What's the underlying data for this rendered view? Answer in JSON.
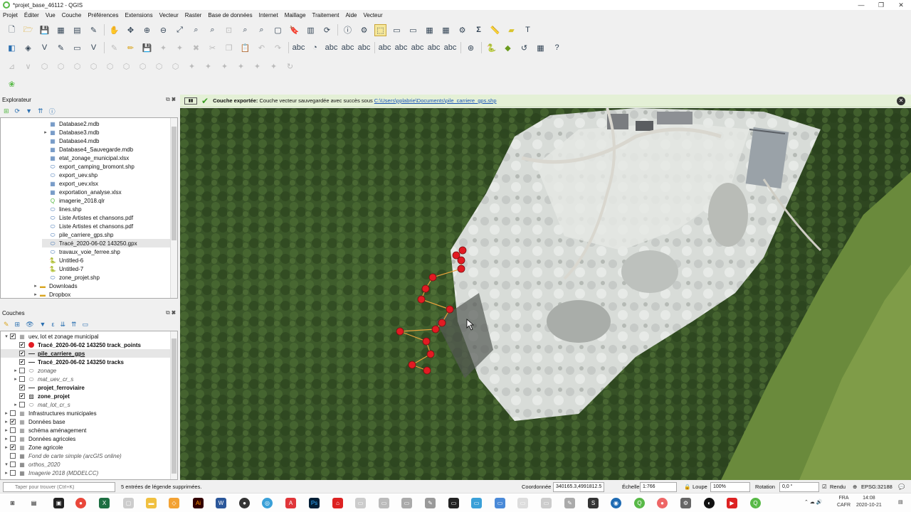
{
  "window": {
    "title": "*projet_base_46112 - QGIS",
    "controls": [
      "—",
      "❐",
      "✕"
    ]
  },
  "menu": [
    "Projet",
    "Éditer",
    "Vue",
    "Couche",
    "Préférences",
    "Extensions",
    "Vecteur",
    "Raster",
    "Base de données",
    "Internet",
    "Maillage",
    "Traitement",
    "Aide",
    "Vecteur"
  ],
  "explorer": {
    "title": "Explorateur",
    "items": [
      {
        "label": "Database2.mdb",
        "icon": "table-icon",
        "arrow": ""
      },
      {
        "label": "Database3.mdb",
        "icon": "table-icon",
        "arrow": "▸"
      },
      {
        "label": "Database4.mdb",
        "icon": "table-icon",
        "arrow": ""
      },
      {
        "label": "Database4_Sauvegarde.mdb",
        "icon": "table-icon",
        "arrow": ""
      },
      {
        "label": "etat_zonage_municipal.xlsx",
        "icon": "table-icon",
        "arrow": ""
      },
      {
        "label": "export_camping_bromont.shp",
        "icon": "vector-icon",
        "arrow": ""
      },
      {
        "label": "export_uev.shp",
        "icon": "vector-icon",
        "arrow": ""
      },
      {
        "label": "export_uev.xlsx",
        "icon": "table-icon",
        "arrow": ""
      },
      {
        "label": "exportation_analyse.xlsx",
        "icon": "table-icon",
        "arrow": ""
      },
      {
        "label": "imagerie_2018.qlr",
        "icon": "qgis-icon",
        "arrow": ""
      },
      {
        "label": "lines.shp",
        "icon": "vector-icon",
        "arrow": ""
      },
      {
        "label": "Liste Artistes et chansons.pdf",
        "icon": "vector-icon",
        "arrow": ""
      },
      {
        "label": "Liste Artistes et chansons.pdf",
        "icon": "vector-icon",
        "arrow": ""
      },
      {
        "label": "pile_carriere_gps.shp",
        "icon": "vector-icon",
        "arrow": ""
      },
      {
        "label": "Tracé_2020-06-02 143250.gpx",
        "icon": "vector-icon",
        "arrow": "",
        "selected": true
      },
      {
        "label": "travaux_voie_ferree.shp",
        "icon": "vector-icon",
        "arrow": ""
      },
      {
        "label": "Untitled-6",
        "icon": "python-icon",
        "arrow": ""
      },
      {
        "label": "Untitled-7",
        "icon": "python-icon",
        "arrow": ""
      },
      {
        "label": "zone_projet.shp",
        "icon": "vector-icon",
        "arrow": ""
      },
      {
        "label": "Downloads",
        "icon": "folder-icon",
        "arrow": "▸",
        "level": 1
      },
      {
        "label": "Dropbox",
        "icon": "folder-icon",
        "arrow": "▸",
        "level": 1
      }
    ]
  },
  "layers": {
    "title": "Couches",
    "items": [
      {
        "label": "uev, lot et zonage municipal",
        "style": "",
        "checked": true,
        "arrow": "▾",
        "icon": "group-icon",
        "level": 0
      },
      {
        "label": "Tracé_2020-06-02 143250 track_points",
        "style": "bold",
        "checked": true,
        "arrow": "",
        "icon": "red-dot-icon",
        "level": 1
      },
      {
        "label": "pile_carriere_gps",
        "style": "underline",
        "checked": true,
        "arrow": "",
        "icon": "line-icon",
        "level": 1
      },
      {
        "label": "Tracé_2020-06-02 143250 tracks",
        "style": "bold",
        "checked": true,
        "arrow": "",
        "icon": "line-icon",
        "level": 1
      },
      {
        "label": "zonage",
        "style": "ital",
        "checked": false,
        "arrow": "▸",
        "icon": "",
        "level": 1
      },
      {
        "label": "mat_uev_cr_s",
        "style": "ital",
        "checked": false,
        "arrow": "▸",
        "icon": "",
        "level": 1
      },
      {
        "label": "projet_ferroviaire",
        "style": "bold",
        "checked": true,
        "arrow": "",
        "icon": "line-icon",
        "level": 1
      },
      {
        "label": "zone_projet",
        "style": "bold",
        "checked": true,
        "arrow": "",
        "icon": "hatch-icon",
        "level": 1
      },
      {
        "label": "mat_lot_cr_s",
        "style": "ital",
        "checked": false,
        "arrow": "▸",
        "icon": "",
        "level": 1
      },
      {
        "label": "Infrastructures municipales",
        "style": "",
        "checked": false,
        "arrow": "▸",
        "icon": "group-icon",
        "level": 0
      },
      {
        "label": "Données base",
        "style": "",
        "checked": true,
        "arrow": "▸",
        "icon": "group-icon",
        "level": 0
      },
      {
        "label": "schéma aménagement",
        "style": "",
        "checked": false,
        "arrow": "▸",
        "icon": "group-icon",
        "level": 0
      },
      {
        "label": "Données agricoles",
        "style": "",
        "checked": false,
        "arrow": "▸",
        "icon": "group-icon",
        "level": 0
      },
      {
        "label": "Zone agricole",
        "style": "",
        "checked": true,
        "arrow": "▸",
        "icon": "group-icon",
        "level": 0
      },
      {
        "label": "Fond de carte simple (arcGIS online)",
        "style": "ital",
        "checked": false,
        "arrow": "",
        "icon": "raster-icon",
        "level": 0
      },
      {
        "label": "orthos_2020",
        "style": "ital",
        "checked": false,
        "arrow": "▾",
        "icon": "raster-icon",
        "level": 0
      },
      {
        "label": "Imagerie 2018 (MDDELCC)",
        "style": "ital",
        "checked": false,
        "arrow": "▸",
        "icon": "raster-icon",
        "level": 0
      }
    ]
  },
  "message": {
    "title": "Couche exportée:",
    "text": "Couche vecteur sauvegardée avec succès sous",
    "link": "C:\\Users\\pplabrie\\Documents\\pile_carriere_gps.shp"
  },
  "status": {
    "search_placeholder": "Taper pour trouver (Ctrl+K)",
    "message": "5 entrées de légende supprimées.",
    "coord_label": "Coordonnée",
    "coord_value": "340165.3,4991812.5",
    "scale_label": "Échelle",
    "scale_value": "1:766",
    "magnifier_label": "Loupe",
    "magnifier_value": "100%",
    "rotation_label": "Rotation",
    "rotation_value": "0,0 °",
    "render_label": "Rendu",
    "crs": "EPSG:32188"
  },
  "taskbar": {
    "lang1": "FRA",
    "lang2": "CAFR",
    "time": "14:08",
    "date": "2020-10-21"
  },
  "colors": {
    "accent_green": "#58b947",
    "track_red": "#e21b23",
    "track_orange": "#e6a23c"
  }
}
